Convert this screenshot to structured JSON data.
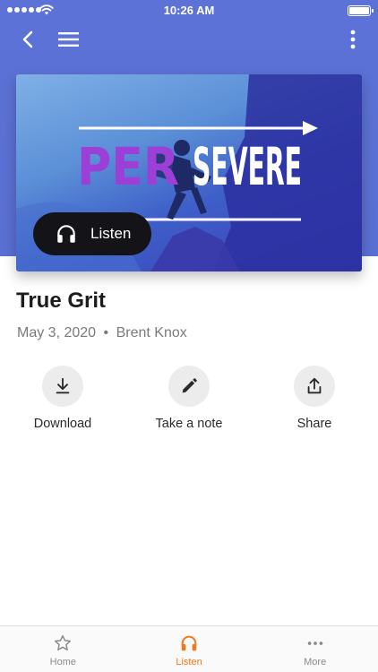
{
  "status_bar": {
    "time": "10:26 AM"
  },
  "artwork": {
    "word_left": "PER",
    "word_right": "SEVERE"
  },
  "listen_button": {
    "label": "Listen",
    "icon": "headphones-icon"
  },
  "sermon": {
    "title": "True Grit",
    "date": "May 3, 2020",
    "separator": "•",
    "speaker": "Brent Knox"
  },
  "actions": [
    {
      "label": "Download",
      "icon": "download-icon"
    },
    {
      "label": "Take a note",
      "icon": "pencil-icon"
    },
    {
      "label": "Share",
      "icon": "share-icon"
    }
  ],
  "tabs": [
    {
      "label": "Home",
      "icon": "star-icon",
      "active": false
    },
    {
      "label": "Listen",
      "icon": "headphones-icon",
      "active": true
    },
    {
      "label": "More",
      "icon": "more-horizontal-icon",
      "active": false
    }
  ],
  "colors": {
    "header_blue": "#5d72d6",
    "accent_orange": "#f0791f",
    "art_purple": "#9b3fd6",
    "pill_dark": "#141418"
  }
}
